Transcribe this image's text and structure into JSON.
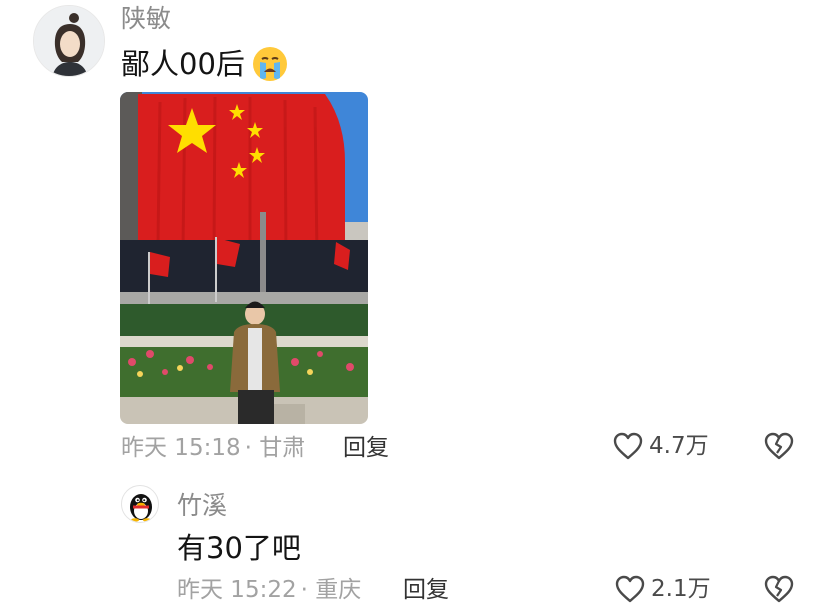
{
  "comment": {
    "username": "陕敏",
    "text": "鄙人00后",
    "emoji_icon": "crying-face-icon",
    "time": "昨天 15:18",
    "location": "· 甘肃",
    "reply_label": "回复",
    "likes": "4.7万"
  },
  "reply": {
    "username": "竹溪",
    "text": "有30了吧",
    "time": "昨天 15:22",
    "location": "· 重庆",
    "reply_label": "回复",
    "likes": "2.1万"
  },
  "colors": {
    "flag_red": "#d91e1e",
    "star_yellow": "#ffde00",
    "sky_blue": "#3f86d8",
    "meta_gray": "#a2a2a2"
  }
}
